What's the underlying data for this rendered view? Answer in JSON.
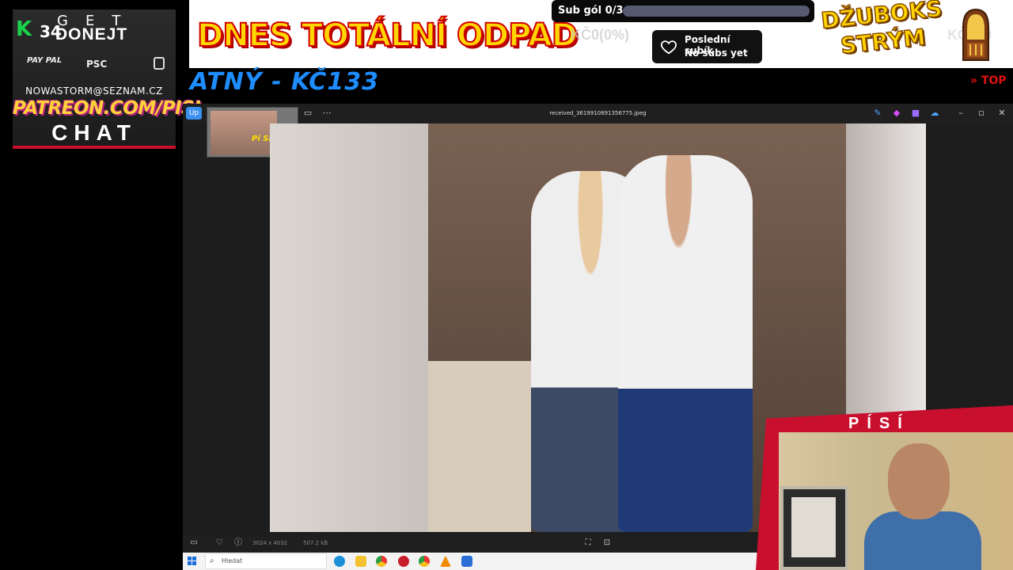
{
  "donate_panel": {
    "k_logo": "K",
    "k_count": "34",
    "get": "GET",
    "donejt": "DONEJT",
    "paypal": "PAY PAL",
    "psc": "PSC",
    "email": "NOWASTORM@SEZNAM.CZ",
    "patreon": "PATREON.COM/PISI",
    "chat": "CHAT",
    "accent": "#c8102e"
  },
  "banner": {
    "title": "DNES TOTÁLNÍ ODPAD",
    "goal_label": "Sub gól 0/3",
    "goal_progress_percent": 0,
    "faded_amount": "KČ0(0%)",
    "sub_title": "Poslední subík",
    "sub_text": "No subs yet",
    "jukebox_title": "DŽUBOKS STRÝM",
    "faded_amount_right": "KČ159",
    "title_color": "#ffd600"
  },
  "ticker": {
    "text": "ATNÝ - KČ133",
    "top_label": "» TOP",
    "color": "#1e8dff"
  },
  "photos_app": {
    "file_name": "received_3619910891356775.jpeg",
    "edit_label": "Up",
    "thumb_label": "Pí Sí TV",
    "image_dimensions": "3024 x 4032",
    "image_size": "507.2 kB"
  },
  "taskbar": {
    "search_placeholder": "Hledat"
  },
  "webcam": {
    "title": "PÍSÍ"
  }
}
